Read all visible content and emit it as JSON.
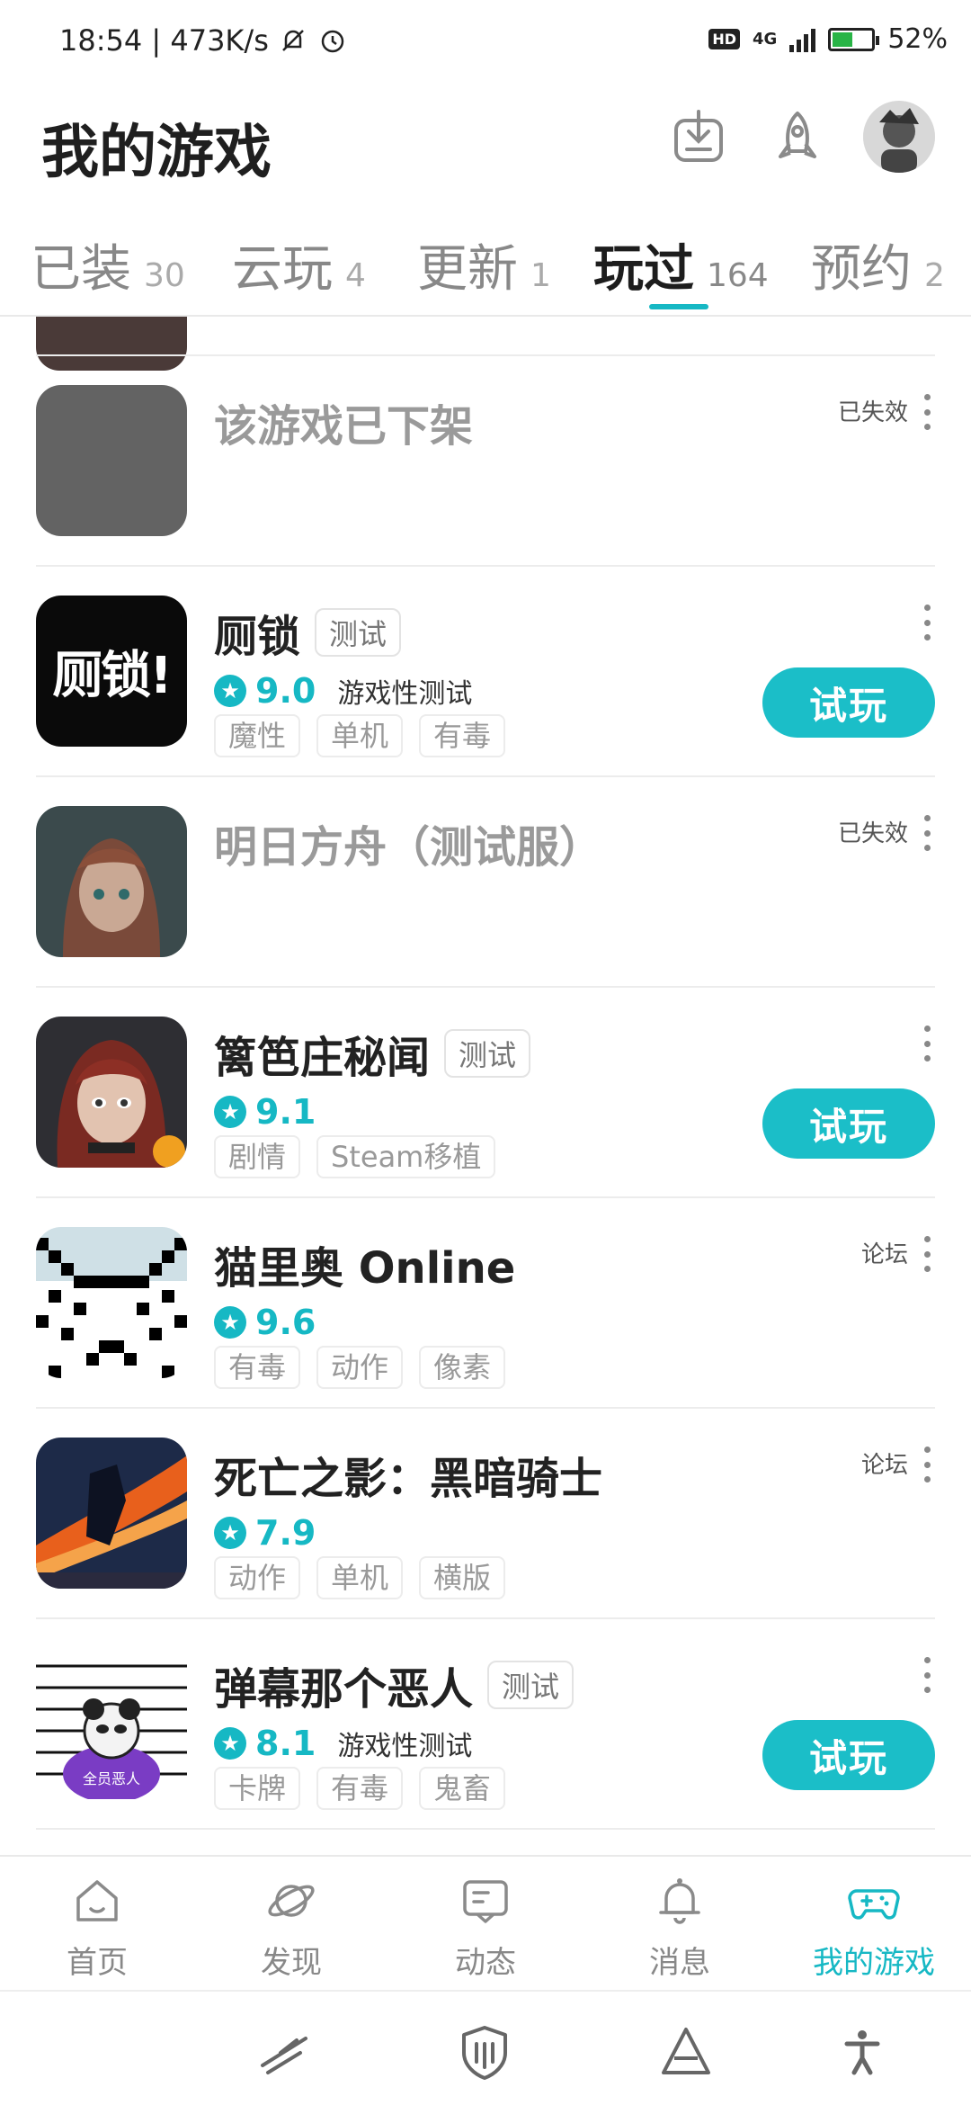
{
  "status_bar": {
    "time_speed": "18:54 | 473K/s",
    "hd": "HD",
    "network": "4G",
    "battery": "52%",
    "battery_level": 0.52
  },
  "header": {
    "title": "我的游戏"
  },
  "tabs": [
    {
      "label": "已装",
      "count": "30"
    },
    {
      "label": "云玩",
      "count": "4"
    },
    {
      "label": "更新",
      "count": "1"
    },
    {
      "label": "玩过",
      "count": "164",
      "active": true
    },
    {
      "label": "预约",
      "count": "2"
    }
  ],
  "games": [
    {
      "name": "该游戏已下架",
      "status": "已失效"
    },
    {
      "name": "厕锁",
      "icon_text": "厕锁!",
      "badge": "测试",
      "score": "9.0",
      "score_note": "游戏性测试",
      "tags": [
        "魔性",
        "单机",
        "有毒"
      ],
      "action": "试玩"
    },
    {
      "name": "明日方舟（测试服）",
      "status": "已失效"
    },
    {
      "name": "篱笆庄秘闻",
      "badge": "测试",
      "score": "9.1",
      "tags": [
        "剧情",
        "Steam移植"
      ],
      "action": "试玩"
    },
    {
      "name": "猫里奥 Online",
      "status": "论坛",
      "score": "9.6",
      "tags": [
        "有毒",
        "动作",
        "像素"
      ]
    },
    {
      "name": "死亡之影：黑暗骑士",
      "status": "论坛",
      "score": "7.9",
      "tags": [
        "动作",
        "单机",
        "横版"
      ]
    },
    {
      "name": "弹幕那个恶人",
      "icon_text": "全员恶人",
      "badge": "测试",
      "score": "8.1",
      "score_note": "游戏性测试",
      "tags": [
        "卡牌",
        "有毒",
        "鬼畜"
      ],
      "action": "试玩"
    }
  ],
  "bottom_nav": [
    {
      "label": "首页",
      "icon": "home-icon"
    },
    {
      "label": "发现",
      "icon": "planet-icon"
    },
    {
      "label": "动态",
      "icon": "message-card-icon"
    },
    {
      "label": "消息",
      "icon": "bell-icon"
    },
    {
      "label": "我的游戏",
      "icon": "gamepad-icon",
      "active": true
    }
  ],
  "colors": {
    "accent": "#16b8c4",
    "button": "#1bbec8"
  }
}
